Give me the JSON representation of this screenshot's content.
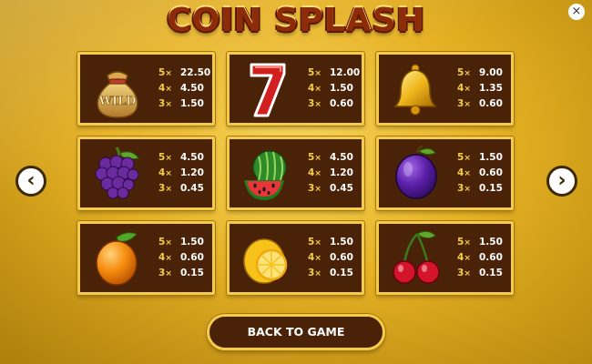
{
  "game": {
    "title": "COIN SPLASH",
    "close_glyph": "×"
  },
  "nav": {
    "prev_glyph": "‹",
    "next_glyph": "›"
  },
  "symbols": [
    {
      "name": "wild-bag",
      "wild_label": "WILD",
      "pays": [
        {
          "mult": "5",
          "value": "22.50"
        },
        {
          "mult": "4",
          "value": "4.50"
        },
        {
          "mult": "3",
          "value": "1.50"
        }
      ]
    },
    {
      "name": "seven",
      "pays": [
        {
          "mult": "5",
          "value": "12.00"
        },
        {
          "mult": "4",
          "value": "1.50"
        },
        {
          "mult": "3",
          "value": "0.60"
        }
      ]
    },
    {
      "name": "bell",
      "pays": [
        {
          "mult": "5",
          "value": "9.00"
        },
        {
          "mult": "4",
          "value": "1.35"
        },
        {
          "mult": "3",
          "value": "0.60"
        }
      ]
    },
    {
      "name": "grapes",
      "pays": [
        {
          "mult": "5",
          "value": "4.50"
        },
        {
          "mult": "4",
          "value": "1.20"
        },
        {
          "mult": "3",
          "value": "0.45"
        }
      ]
    },
    {
      "name": "watermelon",
      "pays": [
        {
          "mult": "5",
          "value": "4.50"
        },
        {
          "mult": "4",
          "value": "1.20"
        },
        {
          "mult": "3",
          "value": "0.45"
        }
      ]
    },
    {
      "name": "plum",
      "pays": [
        {
          "mult": "5",
          "value": "1.50"
        },
        {
          "mult": "4",
          "value": "0.60"
        },
        {
          "mult": "3",
          "value": "0.15"
        }
      ]
    },
    {
      "name": "orange",
      "pays": [
        {
          "mult": "5",
          "value": "1.50"
        },
        {
          "mult": "4",
          "value": "0.60"
        },
        {
          "mult": "3",
          "value": "0.15"
        }
      ]
    },
    {
      "name": "lemon",
      "pays": [
        {
          "mult": "5",
          "value": "1.50"
        },
        {
          "mult": "4",
          "value": "0.60"
        },
        {
          "mult": "3",
          "value": "0.15"
        }
      ]
    },
    {
      "name": "cherries",
      "pays": [
        {
          "mult": "5",
          "value": "1.50"
        },
        {
          "mult": "4",
          "value": "0.60"
        },
        {
          "mult": "3",
          "value": "0.15"
        }
      ]
    }
  ],
  "multiplier_sign": "×",
  "back_button": {
    "label": "BACK TO GAME"
  },
  "colors": {
    "card_bg": "#4a2207",
    "card_border": "#f4cc4b",
    "multiplier": "#f5d048",
    "background": "#e7b224"
  }
}
